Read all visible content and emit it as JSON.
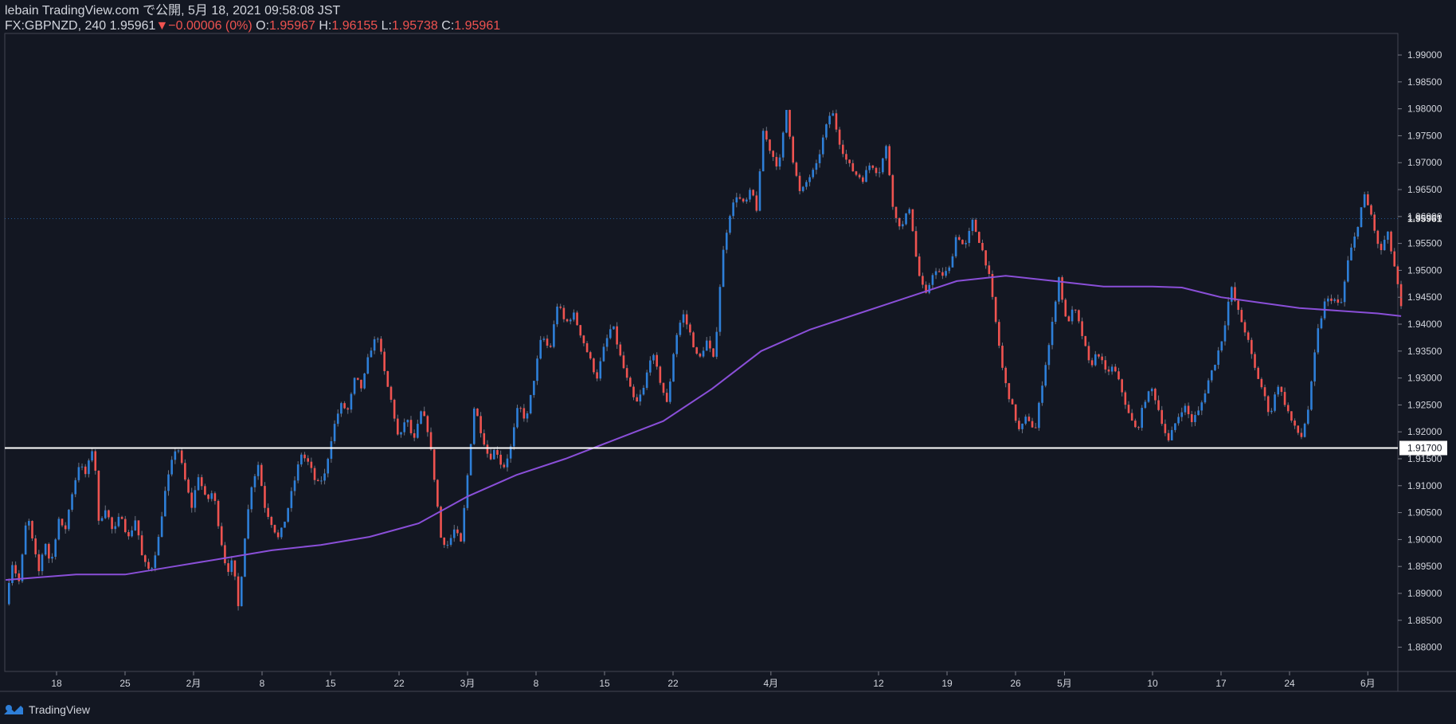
{
  "header": {
    "line1": "lebain TradingView.com で公開, 5月 18, 2021 09:58:08 JST",
    "symbol": "FX:GBPNZD, 240",
    "last": "1.95961",
    "change": "−0.00006 (0%)",
    "o_label": "O:",
    "o_value": "1.95967",
    "h_label": "H:",
    "h_value": "1.96155",
    "l_label": "L:",
    "l_value": "1.95738",
    "c_label": "C:",
    "c_value": "1.95961"
  },
  "footer": {
    "brand": "TradingView"
  },
  "colors": {
    "background": "#131722",
    "up": "#2e7fd8",
    "down": "#ef5350",
    "ma": "#8a4fd8",
    "hline": "#ffffff",
    "text": "#d1d4dc"
  },
  "chart_data": {
    "type": "candlestick",
    "symbol": "FX:GBPNZD",
    "interval": "240",
    "y_axis": {
      "range": [
        1.8755,
        1.994
      ],
      "ticks": [
        "1.88000",
        "1.88500",
        "1.89000",
        "1.89500",
        "1.90000",
        "1.90500",
        "1.91000",
        "1.91500",
        "1.92000",
        "1.92500",
        "1.93000",
        "1.93500",
        "1.94000",
        "1.94500",
        "1.95000",
        "1.95500",
        "1.96000",
        "1.96500",
        "1.97000",
        "1.97500",
        "1.98000",
        "1.98500",
        "1.99000"
      ],
      "last_price_label": "1.95961",
      "last_price": 1.95961,
      "hline_label": "1.91700",
      "hline": 1.917
    },
    "x_axis": {
      "range_days": [
        0,
        101
      ],
      "ticks": [
        {
          "label": "18",
          "day": 3
        },
        {
          "label": "25",
          "day": 10
        },
        {
          "label": "2月",
          "day": 17
        },
        {
          "label": "8",
          "day": 24
        },
        {
          "label": "15",
          "day": 31
        },
        {
          "label": "22",
          "day": 38
        },
        {
          "label": "3月",
          "day": 45
        },
        {
          "label": "8",
          "day": 52
        },
        {
          "label": "15",
          "day": 59
        },
        {
          "label": "22",
          "day": 66
        },
        {
          "label": "4月",
          "day": 76
        },
        {
          "label": "12",
          "day": 87
        },
        {
          "label": "19",
          "day": 94
        },
        {
          "label": "26",
          "day": 101
        },
        {
          "label": "5月",
          "day": 106
        },
        {
          "label": "10",
          "day": 115
        },
        {
          "label": "17",
          "day": 122
        },
        {
          "label": "24",
          "day": 129
        },
        {
          "label": "6月",
          "day": 137
        }
      ],
      "visible_days": [
        -2.5,
        141
      ]
    },
    "price_path": [
      [
        -2.2,
        1.888
      ],
      [
        -1.6,
        1.896
      ],
      [
        -0.8,
        1.892
      ],
      [
        0,
        1.905
      ],
      [
        0.7,
        1.898
      ],
      [
        1.2,
        1.894
      ],
      [
        1.8,
        1.9
      ],
      [
        2.4,
        1.895
      ],
      [
        3.2,
        1.904
      ],
      [
        3.8,
        1.901
      ],
      [
        4.5,
        1.908
      ],
      [
        5.3,
        1.914
      ],
      [
        6.0,
        1.912
      ],
      [
        6.8,
        1.918
      ],
      [
        7.3,
        1.903
      ],
      [
        8.0,
        1.906
      ],
      [
        8.8,
        1.901
      ],
      [
        9.6,
        1.905
      ],
      [
        10.3,
        1.9
      ],
      [
        11.1,
        1.904
      ],
      [
        11.8,
        1.896
      ],
      [
        12.6,
        1.894
      ],
      [
        13.4,
        1.9
      ],
      [
        14.0,
        1.908
      ],
      [
        14.6,
        1.913
      ],
      [
        15.3,
        1.918
      ],
      [
        16.0,
        1.912
      ],
      [
        16.8,
        1.906
      ],
      [
        17.5,
        1.912
      ],
      [
        18.3,
        1.907
      ],
      [
        19.0,
        1.909
      ],
      [
        19.8,
        1.9
      ],
      [
        20.4,
        1.894
      ],
      [
        21.0,
        1.896
      ],
      [
        21.6,
        1.887
      ],
      [
        22.2,
        1.9
      ],
      [
        22.9,
        1.91
      ],
      [
        23.6,
        1.914
      ],
      [
        24.3,
        1.906
      ],
      [
        25.0,
        1.903
      ],
      [
        25.7,
        1.9
      ],
      [
        26.4,
        1.904
      ],
      [
        27.2,
        1.91
      ],
      [
        28.0,
        1.916
      ],
      [
        28.8,
        1.914
      ],
      [
        29.6,
        1.91
      ],
      [
        30.4,
        1.912
      ],
      [
        31.2,
        1.92
      ],
      [
        32.0,
        1.925
      ],
      [
        32.8,
        1.924
      ],
      [
        33.5,
        1.93
      ],
      [
        34.2,
        1.928
      ],
      [
        35.0,
        1.935
      ],
      [
        35.8,
        1.938
      ],
      [
        36.6,
        1.93
      ],
      [
        37.3,
        1.925
      ],
      [
        38.0,
        1.918
      ],
      [
        38.7,
        1.923
      ],
      [
        39.5,
        1.918
      ],
      [
        40.3,
        1.924
      ],
      [
        41.0,
        1.92
      ],
      [
        41.7,
        1.91
      ],
      [
        42.3,
        1.9
      ],
      [
        43.0,
        1.899
      ],
      [
        43.7,
        1.902
      ],
      [
        44.3,
        1.899
      ],
      [
        45.0,
        1.912
      ],
      [
        45.7,
        1.925
      ],
      [
        46.4,
        1.92
      ],
      [
        47.2,
        1.915
      ],
      [
        47.9,
        1.917
      ],
      [
        48.6,
        1.913
      ],
      [
        49.4,
        1.917
      ],
      [
        50.2,
        1.925
      ],
      [
        51.0,
        1.922
      ],
      [
        51.8,
        1.93
      ],
      [
        52.6,
        1.938
      ],
      [
        53.4,
        1.935
      ],
      [
        54.2,
        1.944
      ],
      [
        55.0,
        1.94
      ],
      [
        55.8,
        1.942
      ],
      [
        56.6,
        1.938
      ],
      [
        57.4,
        1.934
      ],
      [
        58.2,
        1.93
      ],
      [
        59.0,
        1.936
      ],
      [
        59.8,
        1.94
      ],
      [
        60.6,
        1.934
      ],
      [
        61.4,
        1.929
      ],
      [
        62.2,
        1.925
      ],
      [
        63.0,
        1.928
      ],
      [
        63.8,
        1.935
      ],
      [
        64.6,
        1.93
      ],
      [
        65.4,
        1.925
      ],
      [
        66.2,
        1.937
      ],
      [
        67.0,
        1.942
      ],
      [
        67.8,
        1.938
      ],
      [
        68.6,
        1.933
      ],
      [
        69.4,
        1.937
      ],
      [
        70.2,
        1.933
      ],
      [
        71.0,
        1.952
      ],
      [
        71.7,
        1.96
      ],
      [
        72.5,
        1.964
      ],
      [
        73.3,
        1.962
      ],
      [
        74.0,
        1.965
      ],
      [
        74.6,
        1.961
      ],
      [
        75.2,
        1.976
      ],
      [
        76.0,
        1.972
      ],
      [
        76.8,
        1.969
      ],
      [
        77.6,
        1.98
      ],
      [
        78.3,
        1.97
      ],
      [
        79.0,
        1.964
      ],
      [
        79.8,
        1.967
      ],
      [
        80.6,
        1.969
      ],
      [
        81.4,
        1.975
      ],
      [
        82.2,
        1.98
      ],
      [
        83.0,
        1.974
      ],
      [
        83.8,
        1.97
      ],
      [
        84.6,
        1.968
      ],
      [
        85.4,
        1.967
      ],
      [
        86.2,
        1.97
      ],
      [
        87.0,
        1.968
      ],
      [
        87.8,
        1.973
      ],
      [
        88.6,
        1.96
      ],
      [
        89.4,
        1.958
      ],
      [
        90.2,
        1.962
      ],
      [
        91.0,
        1.95
      ],
      [
        91.8,
        1.945
      ],
      [
        92.6,
        1.95
      ],
      [
        93.4,
        1.949
      ],
      [
        94.2,
        1.95
      ],
      [
        95.0,
        1.957
      ],
      [
        95.8,
        1.954
      ],
      [
        96.6,
        1.959
      ],
      [
        97.4,
        1.955
      ],
      [
        98.2,
        1.95
      ],
      [
        99.0,
        1.94
      ],
      [
        99.8,
        1.93
      ],
      [
        100.6,
        1.925
      ],
      [
        101.4,
        1.92
      ],
      [
        102.2,
        1.923
      ],
      [
        103.0,
        1.92
      ],
      [
        103.8,
        1.93
      ],
      [
        104.6,
        1.938
      ],
      [
        105.4,
        1.949
      ],
      [
        106.2,
        1.94
      ],
      [
        107.0,
        1.943
      ],
      [
        107.8,
        1.938
      ],
      [
        108.6,
        1.932
      ],
      [
        109.4,
        1.935
      ],
      [
        110.2,
        1.931
      ],
      [
        111.0,
        1.932
      ],
      [
        111.8,
        1.928
      ],
      [
        112.6,
        1.923
      ],
      [
        113.4,
        1.92
      ],
      [
        114.2,
        1.926
      ],
      [
        115.0,
        1.928
      ],
      [
        115.8,
        1.923
      ],
      [
        116.6,
        1.918
      ],
      [
        117.4,
        1.922
      ],
      [
        118.2,
        1.925
      ],
      [
        119.0,
        1.922
      ],
      [
        119.8,
        1.924
      ],
      [
        120.6,
        1.929
      ],
      [
        121.4,
        1.933
      ],
      [
        122.2,
        1.938
      ],
      [
        123.0,
        1.947
      ],
      [
        123.8,
        1.942
      ],
      [
        124.6,
        1.938
      ],
      [
        125.4,
        1.932
      ],
      [
        126.2,
        1.928
      ],
      [
        127.0,
        1.923
      ],
      [
        127.8,
        1.929
      ],
      [
        128.6,
        1.925
      ],
      [
        129.4,
        1.921
      ],
      [
        130.2,
        1.919
      ],
      [
        131.0,
        1.925
      ],
      [
        131.8,
        1.938
      ],
      [
        132.6,
        1.944
      ],
      [
        133.4,
        1.945
      ],
      [
        134.2,
        1.943
      ],
      [
        135.0,
        1.952
      ],
      [
        135.8,
        1.957
      ],
      [
        136.6,
        1.964
      ],
      [
        137.4,
        1.96
      ],
      [
        138.2,
        1.953
      ],
      [
        139.0,
        1.957
      ],
      [
        139.8,
        1.95
      ],
      [
        140.4,
        1.943
      ]
    ],
    "ma_path": [
      [
        -2.2,
        1.8925
      ],
      [
        5,
        1.8935
      ],
      [
        10,
        1.8935
      ],
      [
        15,
        1.895
      ],
      [
        20,
        1.8965
      ],
      [
        25,
        1.898
      ],
      [
        30,
        1.899
      ],
      [
        35,
        1.9005
      ],
      [
        40,
        1.903
      ],
      [
        45,
        1.908
      ],
      [
        50,
        1.912
      ],
      [
        55,
        1.915
      ],
      [
        60,
        1.9185
      ],
      [
        65,
        1.922
      ],
      [
        70,
        1.928
      ],
      [
        75,
        1.935
      ],
      [
        80,
        1.939
      ],
      [
        85,
        1.942
      ],
      [
        90,
        1.945
      ],
      [
        95,
        1.948
      ],
      [
        100,
        1.949
      ],
      [
        105,
        1.948
      ],
      [
        110,
        1.947
      ],
      [
        115,
        1.947
      ],
      [
        118,
        1.9468
      ],
      [
        122,
        1.945
      ],
      [
        126,
        1.944
      ],
      [
        130,
        1.943
      ],
      [
        134,
        1.9425
      ],
      [
        138,
        1.942
      ],
      [
        140.4,
        1.9415
      ]
    ],
    "horizontal_line": 1.917,
    "candles_count": 420
  }
}
